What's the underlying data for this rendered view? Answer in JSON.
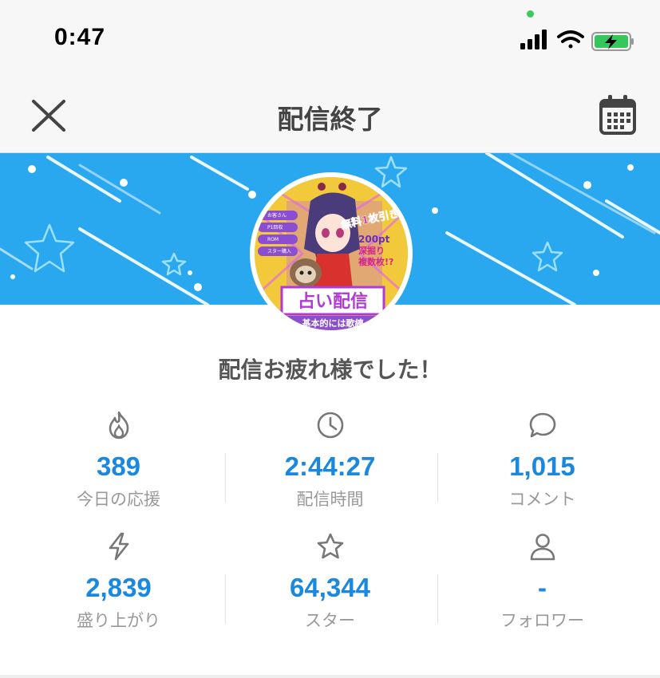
{
  "status_bar": {
    "time": "0:47"
  },
  "nav": {
    "title": "配信終了",
    "close_icon": "close-icon",
    "calendar_icon": "calendar-icon"
  },
  "profile": {
    "thumbnail_text": {
      "menu_items": [
        "お客さん",
        "P1回収",
        "ROM",
        "スター購入"
      ],
      "headline": "無料1枚引き？",
      "subline1": "200pt",
      "subline2": "深掘り",
      "subline3": "複数枚!?",
      "banner_title": "占い配信",
      "banner_sub": "基本的には歌練"
    }
  },
  "message": "配信お疲れ様でした！",
  "stats": [
    {
      "icon": "fire-icon",
      "value": "389",
      "label": "今日の応援"
    },
    {
      "icon": "clock-icon",
      "value": "2:44:27",
      "label": "配信時間"
    },
    {
      "icon": "comment-icon",
      "value": "1,015",
      "label": "コメント"
    },
    {
      "icon": "lightning-icon",
      "value": "2,839",
      "label": "盛り上がり"
    },
    {
      "icon": "star-icon",
      "value": "64,344",
      "label": "スター"
    },
    {
      "icon": "person-icon",
      "value": "-",
      "label": "フォロワー"
    }
  ],
  "colors": {
    "accent": "#1a88df",
    "banner": "#29a8ef",
    "background": "#f7f7f8"
  }
}
